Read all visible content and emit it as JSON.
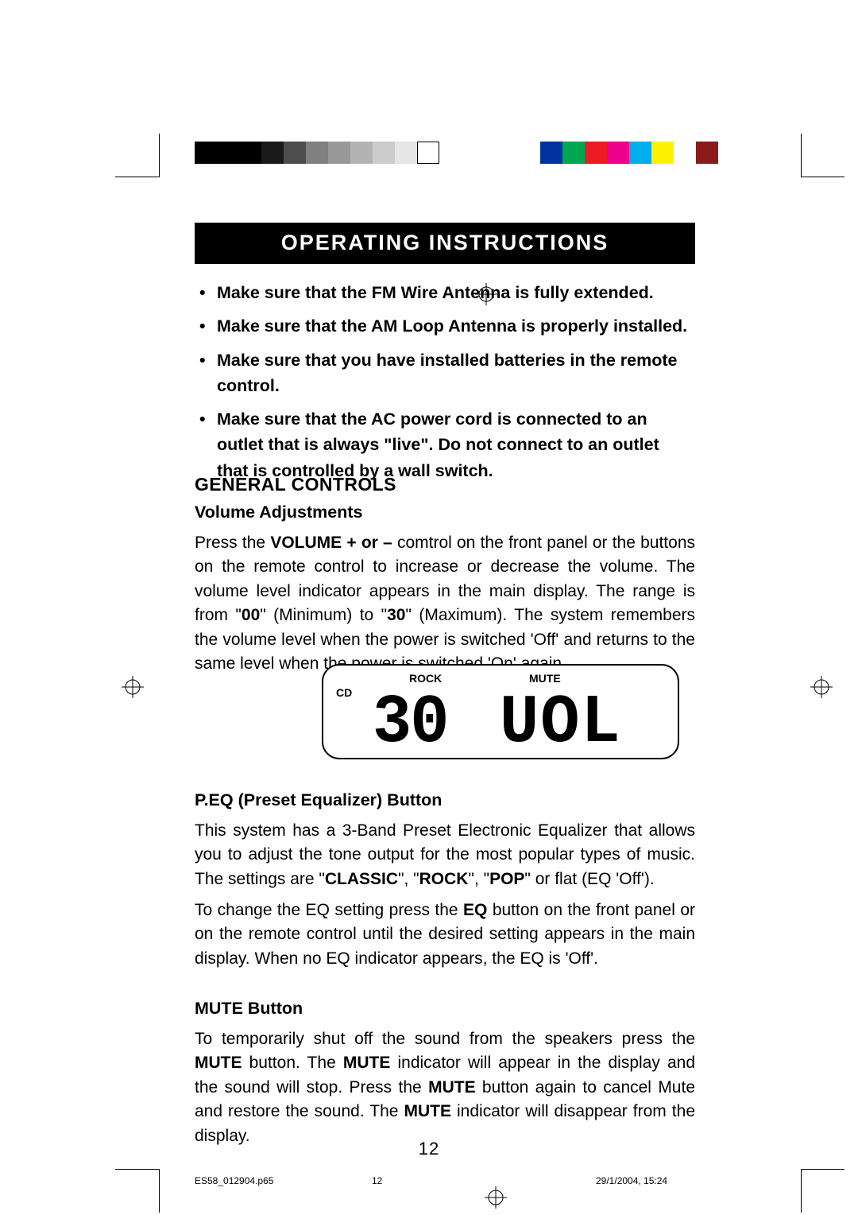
{
  "header": {
    "title": "OPERATING INSTRUCTIONS"
  },
  "bullets": {
    "i0": "Make sure that the FM Wire Antenna is fully extended.",
    "i1": "Make sure that the AM Loop Antenna is properly installed.",
    "i2": "Make sure that you have installed batteries in the remote control.",
    "i3": "Make sure that the AC power cord is connected to an outlet that is always \"live\". Do not connect to an outlet that is controlled by a wall switch."
  },
  "headings": {
    "general": "GENERAL CONTROLS",
    "volume": "Volume Adjustments",
    "peq": "P.EQ (Preset Equalizer) Button",
    "mute": "MUTE Button"
  },
  "volume_para": {
    "t0": "Press the ",
    "t1": "VOLUME + or –",
    "t2": " comtrol on the front panel or the buttons on the remote control to increase or decrease the volume. The volume level indicator appears in the main display. The range is from \"",
    "t3": "00",
    "t4": "\" (Minimum) to \"",
    "t5": "30",
    "t6": "\" (Maximum). The system remembers the volume level when the power is switched 'Off' and returns to the same level when the power is switched 'On' again."
  },
  "display": {
    "cd": "CD",
    "rock": "ROCK",
    "mute": "MUTE",
    "seg30": "30",
    "segvol": "UOL"
  },
  "peq_para1": {
    "t0": "This system has a 3-Band Preset Electronic Equalizer that allows you to adjust the tone output for the most popular types of music. The settings are \"",
    "t1": "CLASSIC",
    "t2": "\", \"",
    "t3": "ROCK",
    "t4": "\", \"",
    "t5": "POP",
    "t6": "\" or flat (EQ 'Off')."
  },
  "peq_para2": {
    "t0": "To change the EQ setting press the ",
    "t1": "EQ",
    "t2": " button on the front panel or on the remote control until the desired setting appears in the main display. When no EQ indicator appears, the EQ is 'Off'."
  },
  "mute_para": {
    "t0": "To temporarily shut off the sound from the speakers press the ",
    "t1": "MUTE",
    "t2": " button. The ",
    "t3": "MUTE",
    "t4": " indicator will appear in the display and the sound will stop. Press the ",
    "t5": "MUTE",
    "t6": " button again to cancel Mute and restore the sound. The ",
    "t7": "MUTE",
    "t8": " indicator will disappear from the display."
  },
  "pagenum": "12",
  "footer": {
    "filename": "ES58_012904.p65",
    "page": "12",
    "datetime": "29/1/2004, 15:24"
  },
  "colorbar": {
    "gray": [
      "#000000",
      "#1a1a1a",
      "#333333",
      "#4d4d4d",
      "#666666",
      "#808080",
      "#999999",
      "#b3b3b3",
      "#cccccc",
      "#e6e6e6",
      "#ffffff"
    ],
    "color": [
      "#0033a0",
      "#00a651",
      "#ed1c24",
      "#ec008c",
      "#00aeef",
      "#fff200",
      "#ffffff",
      "#8b1a1a"
    ]
  }
}
